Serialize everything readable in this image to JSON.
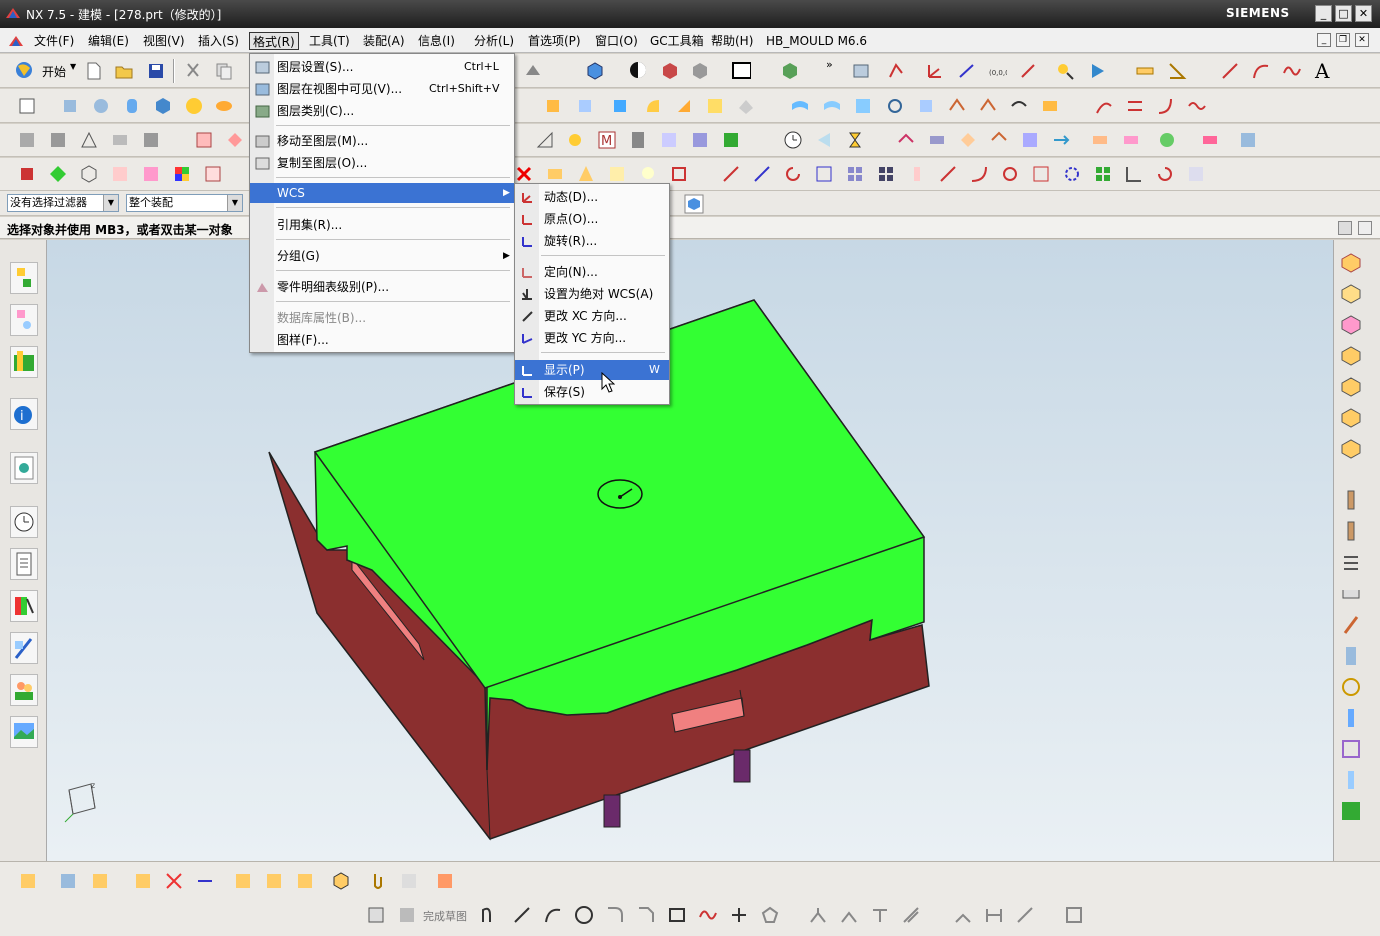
{
  "window": {
    "title": "NX 7.5 - 建模 - [278.prt（修改的）]",
    "brand": "SIEMENS",
    "controls": [
      "_",
      "□",
      "✕"
    ]
  },
  "menubar": {
    "items": [
      "文件(F)",
      "编辑(E)",
      "视图(V)",
      "插入(S)",
      "格式(R)",
      "工具(T)",
      "装配(A)",
      "信息(I)",
      "分析(L)",
      "首选项(P)",
      "窗口(O)",
      "GC工具箱",
      "帮助(H)",
      "HB_MOULD M6.6"
    ],
    "active_index": 4
  },
  "toolbar": {
    "start_label": "开始"
  },
  "filters": {
    "selection_filter": "没有选择过滤器",
    "scope": "整个装配"
  },
  "status": {
    "prompt": "选择对象并使用 MB3，或者双击某一对象"
  },
  "format_menu": {
    "items": [
      {
        "label": "图层设置(S)...",
        "shortcut": "Ctrl+L"
      },
      {
        "label": "图层在视图中可见(V)...",
        "shortcut": "Ctrl+Shift+V"
      },
      {
        "label": "图层类别(C)...",
        "shortcut": ""
      },
      {
        "label": "移动至图层(M)...",
        "shortcut": ""
      },
      {
        "label": "复制至图层(O)...",
        "shortcut": ""
      },
      {
        "label": "WCS",
        "shortcut": ""
      },
      {
        "label": "引用集(R)...",
        "shortcut": ""
      },
      {
        "label": "分组(G)",
        "shortcut": ""
      },
      {
        "label": "零件明细表级别(P)...",
        "shortcut": ""
      },
      {
        "label": "数据库属性(B)...",
        "shortcut": ""
      },
      {
        "label": "图样(F)...",
        "shortcut": ""
      }
    ]
  },
  "wcs_menu": {
    "items": [
      {
        "label": "动态(D)...",
        "shortcut": ""
      },
      {
        "label": "原点(O)...",
        "shortcut": ""
      },
      {
        "label": "旋转(R)...",
        "shortcut": ""
      },
      {
        "label": "定向(N)...",
        "shortcut": ""
      },
      {
        "label": "设置为绝对 WCS(A)",
        "shortcut": ""
      },
      {
        "label": "更改 XC 方向...",
        "shortcut": ""
      },
      {
        "label": "更改 YC 方向...",
        "shortcut": ""
      },
      {
        "label": "显示(P)",
        "shortcut": "W"
      },
      {
        "label": "保存(S)",
        "shortcut": ""
      }
    ],
    "highlighted_index": 7
  },
  "sketch_toolbar": {
    "finish_label": "完成草图"
  },
  "colors": {
    "mold_top": "#33ff33",
    "mold_bottom": "#8b2f2f",
    "highlight": "#3b73d3",
    "viewport_top": "#c7d8e5"
  },
  "icons": [
    "nx-logo-icon",
    "start-icon",
    "new-file-icon",
    "open-folder-icon",
    "save-icon",
    "cut-icon",
    "copy-icon",
    "layer-settings-icon",
    "wcs-dynamic-icon",
    "wcs-origin-icon",
    "wcs-rotate-icon",
    "wcs-orient-icon",
    "wcs-absolute-icon",
    "wcs-change-xc-icon",
    "wcs-change-yc-icon",
    "wcs-display-icon",
    "wcs-save-icon",
    "parts-list-icon",
    "submenu-arrow-icon",
    "mouse-cursor-icon",
    "csys-triad-icon"
  ]
}
